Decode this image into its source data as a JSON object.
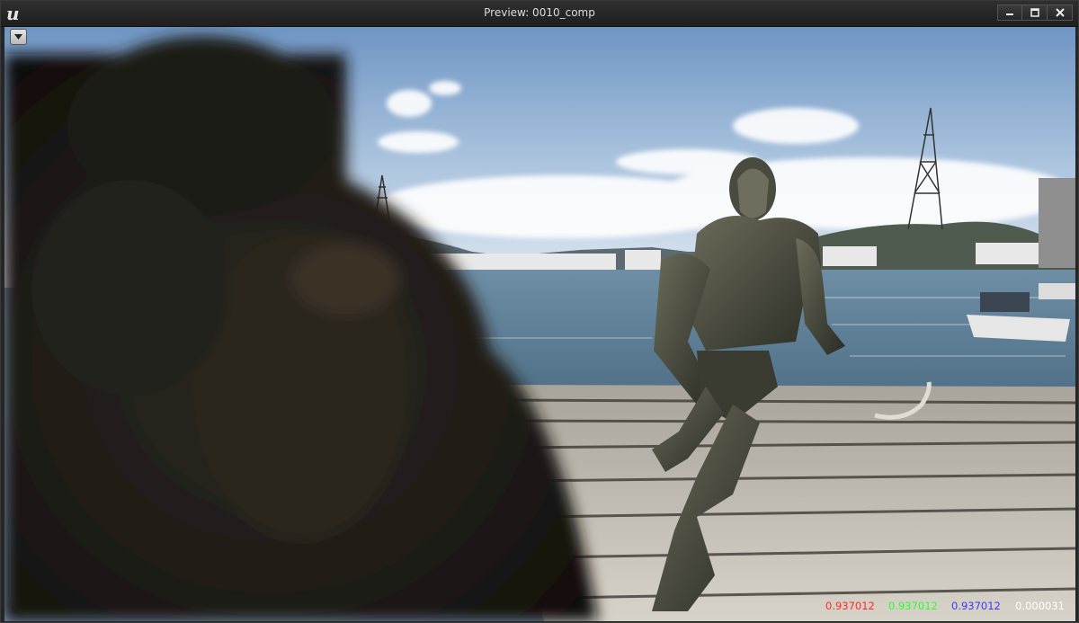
{
  "window": {
    "title": "Preview: 0010_comp",
    "logo_text": "u",
    "controls": [
      "minimize",
      "maximize",
      "close"
    ]
  },
  "viewport": {
    "options_icon": "chevron-down-icon"
  },
  "pixel_readout": {
    "r": "0.937012",
    "g": "0.937012",
    "b": "0.937012",
    "a": "0.000031"
  },
  "colors": {
    "red": "#ff2a2a",
    "green": "#2aff2a",
    "blue": "#3a3aff",
    "alpha": "#ffffff"
  }
}
